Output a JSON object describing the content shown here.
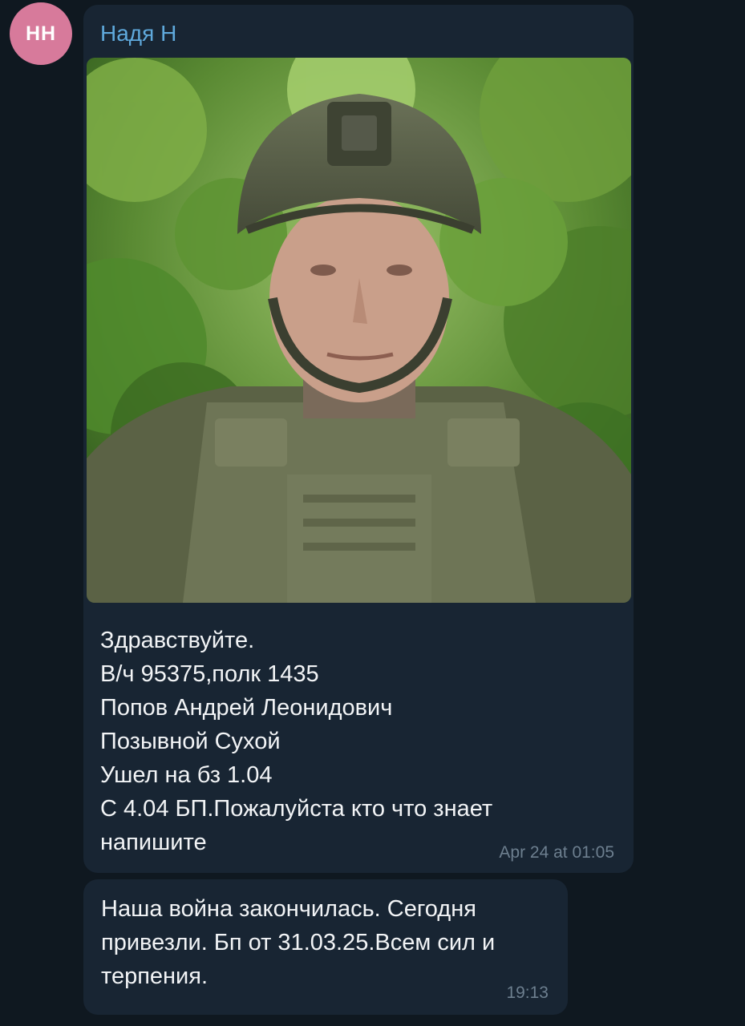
{
  "sender": {
    "name": "Надя Н",
    "initials": "НН",
    "avatar_color": "#d77a9b"
  },
  "messages": [
    {
      "lines": [
        "Здравствуйте.",
        "В/ч 95375,полк 1435",
        "Попов Андрей Леонидович",
        "Позывной Сухой",
        "Ушел на бз 1.04",
        "С 4.04 БП.Пожалуйста кто что знает",
        "напишите"
      ],
      "time": "Apr 24 at 01:05",
      "has_photo": true
    },
    {
      "lines": [
        "Наша война закончилась. Сегодня",
        "привезли. Бп от 31.03.25.Всем сил и",
        "терпения."
      ],
      "time": "19:13"
    }
  ],
  "colors": {
    "background": "#0f1820",
    "bubble": "#182533",
    "sender_name": "#5fa9dc",
    "text": "#f2f4f6",
    "time": "#6d7f8f"
  }
}
